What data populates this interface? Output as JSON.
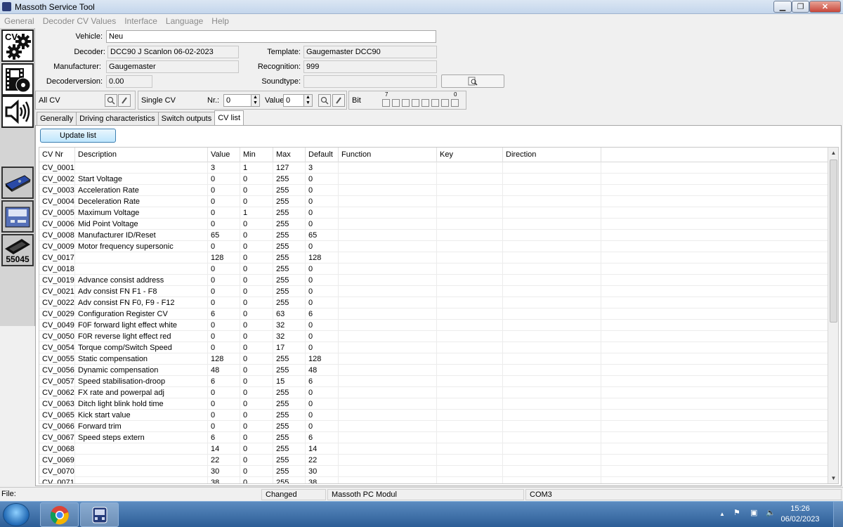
{
  "window": {
    "title": "Massoth Service Tool"
  },
  "menu": [
    "General",
    "Decoder CV Values",
    "Interface",
    "Language",
    "Help"
  ],
  "info": {
    "vehicle_label": "Vehicle:",
    "vehicle_value": "Neu",
    "decoder_label": "Decoder:",
    "decoder_value": "DCC90  J Scanlon 06-02-2023",
    "template_label": "Template:",
    "template_value": "Gaugemaster DCC90",
    "manufacturer_label": "Manufacturer:",
    "manufacturer_value": "Gaugemaster",
    "recognition_label": "Recognition:",
    "recognition_value": "999",
    "decoderversion_label": "Decoderversion:",
    "decoderversion_value": "0.00",
    "soundtype_label": "Soundtype:",
    "soundtype_value": ""
  },
  "left_toolbar": {
    "cv_label": "CV",
    "device_number": "55045"
  },
  "cv_controls": {
    "all_cv_label": "All CV",
    "single_cv_label": "Single CV",
    "nr_label": "Nr.:",
    "nr_value": "0",
    "value_label": "Value",
    "value_value": "0",
    "bit_label": "Bit",
    "bit_high": "7",
    "bit_low": "0"
  },
  "tabs": [
    "Generally",
    "Driving characteristics",
    "Switch outputs",
    "CV list"
  ],
  "active_tab": "CV list",
  "update_button": "Update list",
  "grid": {
    "columns": [
      "CV Nr",
      "Description",
      "Value",
      "Min",
      "Max",
      "Default",
      "Function",
      "Key",
      "Direction"
    ],
    "rows": [
      [
        "CV_0001",
        "",
        "3",
        "1",
        "127",
        "3"
      ],
      [
        "CV_0002",
        "Start Voltage",
        "0",
        "0",
        "255",
        "0"
      ],
      [
        "CV_0003",
        "Acceleration Rate",
        "0",
        "0",
        "255",
        "0"
      ],
      [
        "CV_0004",
        "Deceleration Rate",
        "0",
        "0",
        "255",
        "0"
      ],
      [
        "CV_0005",
        "Maximum Voltage",
        "0",
        "1",
        "255",
        "0"
      ],
      [
        "CV_0006",
        "Mid Point Voltage",
        "0",
        "0",
        "255",
        "0"
      ],
      [
        "CV_0008",
        "Manufacturer ID/Reset",
        "65",
        "0",
        "255",
        "65"
      ],
      [
        "CV_0009",
        "Motor frequency supersonic",
        "0",
        "0",
        "255",
        "0"
      ],
      [
        "CV_0017",
        "",
        "128",
        "0",
        "255",
        "128"
      ],
      [
        "CV_0018",
        "",
        "0",
        "0",
        "255",
        "0"
      ],
      [
        "CV_0019",
        "Advance consist address",
        "0",
        "0",
        "255",
        "0"
      ],
      [
        "CV_0021",
        "Adv consist FN F1 - F8",
        "0",
        "0",
        "255",
        "0"
      ],
      [
        "CV_0022",
        "Adv consist FN F0, F9 - F12",
        "0",
        "0",
        "255",
        "0"
      ],
      [
        "CV_0029",
        "Configuration Register CV",
        "6",
        "0",
        "63",
        "6"
      ],
      [
        "CV_0049",
        "F0F forward light effect white",
        "0",
        "0",
        "32",
        "0"
      ],
      [
        "CV_0050",
        "F0R reverse light effect red",
        "0",
        "0",
        "32",
        "0"
      ],
      [
        "CV_0054",
        "Torque comp/Switch Speed",
        "0",
        "0",
        "17",
        "0"
      ],
      [
        "CV_0055",
        "Static compensation",
        "128",
        "0",
        "255",
        "128"
      ],
      [
        "CV_0056",
        "Dynamic compensation",
        "48",
        "0",
        "255",
        "48"
      ],
      [
        "CV_0057",
        "Speed stabilisation-droop",
        "6",
        "0",
        "15",
        "6"
      ],
      [
        "CV_0062",
        "FX rate and powerpal adj",
        "0",
        "0",
        "255",
        "0"
      ],
      [
        "CV_0063",
        "Ditch light blink hold time",
        "0",
        "0",
        "255",
        "0"
      ],
      [
        "CV_0065",
        "Kick start value",
        "0",
        "0",
        "255",
        "0"
      ],
      [
        "CV_0066",
        "Forward trim",
        "0",
        "0",
        "255",
        "0"
      ],
      [
        "CV_0067",
        "Speed steps extern",
        "6",
        "0",
        "255",
        "6"
      ],
      [
        "CV_0068",
        "",
        "14",
        "0",
        "255",
        "14"
      ],
      [
        "CV_0069",
        "",
        "22",
        "0",
        "255",
        "22"
      ],
      [
        "CV_0070",
        "",
        "30",
        "0",
        "255",
        "30"
      ],
      [
        "CV_0071",
        "",
        "38",
        "0",
        "255",
        "38"
      ]
    ]
  },
  "status": {
    "file_label": "File:",
    "changed": "Changed",
    "module": "Massoth PC Modul",
    "port": "COM3"
  },
  "taskbar": {
    "time": "15:26",
    "date": "06/02/2023"
  }
}
